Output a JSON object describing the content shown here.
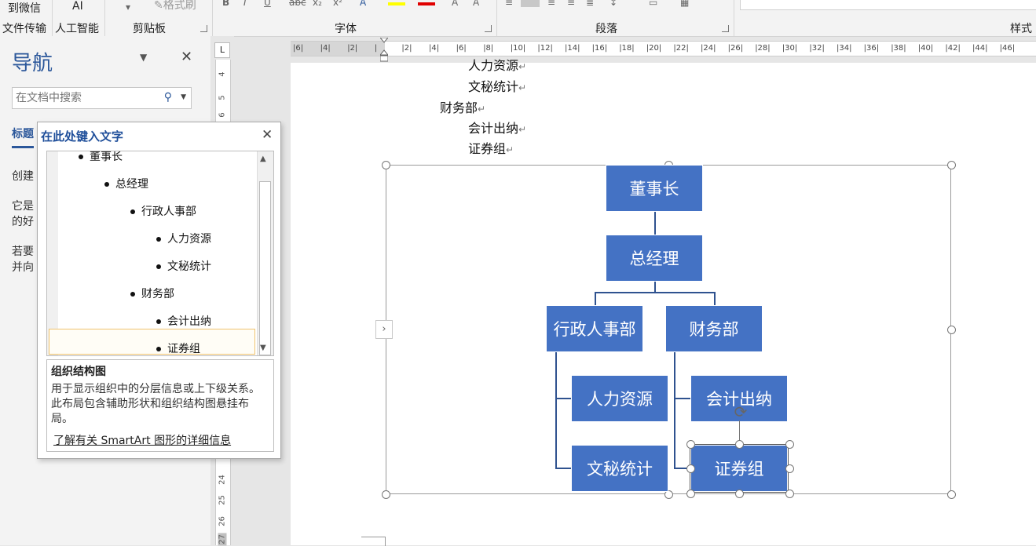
{
  "ribbon": {
    "top_fragments": [
      "到微信",
      "AI"
    ],
    "format_painter": "格式刷",
    "labels": [
      "文件传输",
      "人工智能"
    ],
    "groups": [
      "剪贴板",
      "字体",
      "段落",
      "样式"
    ]
  },
  "nav": {
    "title": "导航",
    "search_placeholder": "在文档中搜索",
    "tab_headings": "标题",
    "text1": "创建",
    "text2a": "它是",
    "text2b": "的好",
    "text3a": "若要",
    "text3b": "并向"
  },
  "vruler": {
    "corner": "L",
    "numbers": [
      "4",
      "5",
      "6",
      "24",
      "25",
      "26",
      "27"
    ]
  },
  "hruler": {
    "ticks": [
      "|6|",
      "|4|",
      "|2|",
      "|",
      "|2|",
      "|4|",
      "|6|",
      "|8|",
      "|10|",
      "|12|",
      "|14|",
      "|16|",
      "|18|",
      "|20|",
      "|22|",
      "|24|",
      "|26|",
      "|28|",
      "|30|",
      "|32|",
      "|34|",
      "|36|",
      "|38|",
      "|40|",
      "|42|",
      "|44|",
      "|46|"
    ]
  },
  "doc": {
    "lines": [
      "人力资源",
      "文秘统计",
      "财务部",
      "会计出纳",
      "证券组"
    ],
    "para_mark": "↵"
  },
  "smartart": {
    "nodes": {
      "chairman": "董事长",
      "gm": "总经理",
      "admin_hr": "行政人事部",
      "finance": "财务部",
      "hr": "人力资源",
      "secretary": "文秘统计",
      "accounting": "会计出纳",
      "securities": "证券组"
    }
  },
  "text_pane": {
    "title": "在此处键入文字",
    "items": [
      {
        "text": "董事长",
        "level": 1
      },
      {
        "text": "总经理",
        "level": 2
      },
      {
        "text": "行政人事部",
        "level": 3
      },
      {
        "text": "人力资源",
        "level": 4
      },
      {
        "text": "文秘统计",
        "level": 4
      },
      {
        "text": "财务部",
        "level": 3
      },
      {
        "text": "会计出纳",
        "level": 4
      },
      {
        "text": "证券组",
        "level": 4
      }
    ],
    "desc_title": "组织结构图",
    "desc_body": "用于显示组织中的分层信息或上下级关系。此布局包含辅助形状和组织结构图悬挂布局。",
    "link": "了解有关 SmartArt 图形的详细信息"
  }
}
